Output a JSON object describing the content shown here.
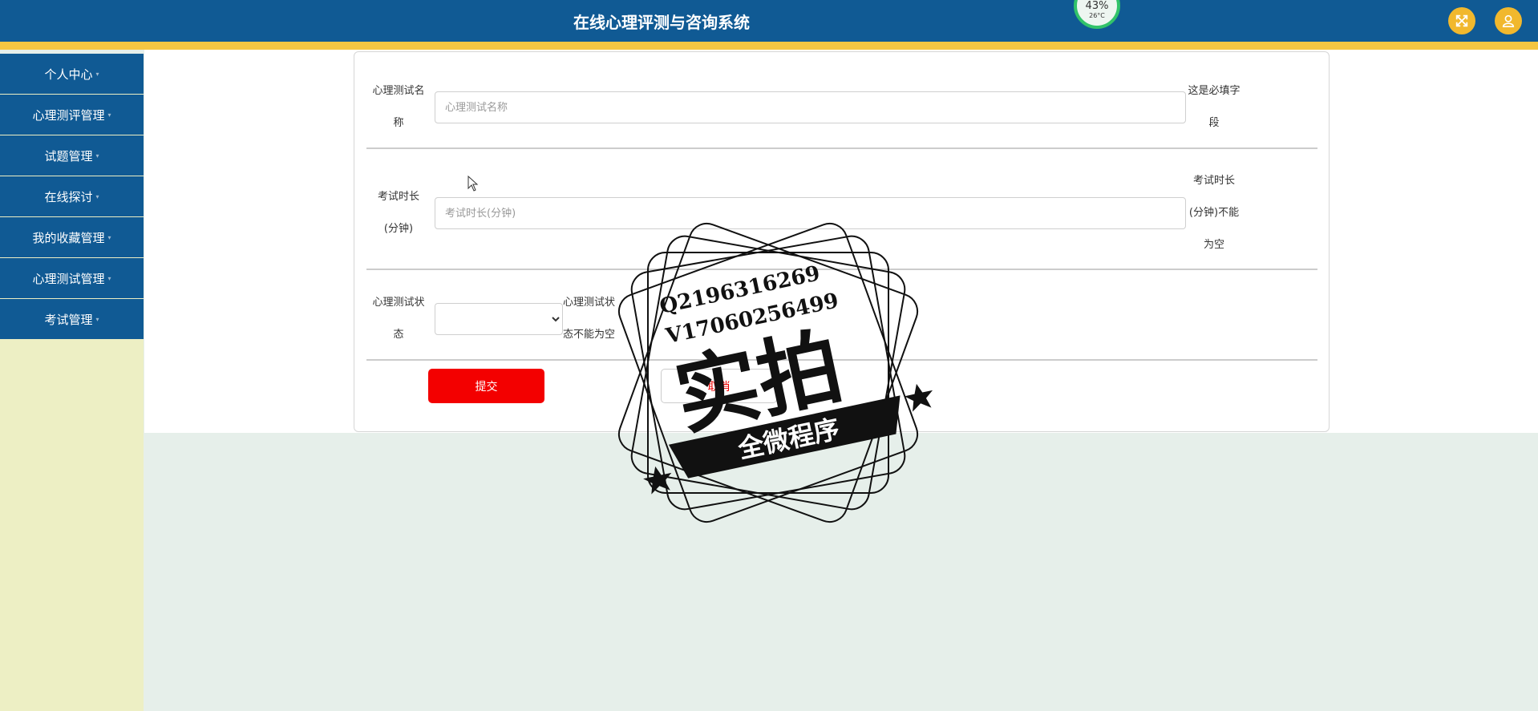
{
  "header": {
    "title": "在线心理评测与咨询系统",
    "status_widget": {
      "percent": "43%",
      "temperature": "26°C"
    },
    "accent_color": "#105a94",
    "stripe_color": "#f5c642"
  },
  "sidebar": {
    "items": [
      {
        "label": "个人中心"
      },
      {
        "label": "心理测评管理"
      },
      {
        "label": "试题管理"
      },
      {
        "label": "在线探讨"
      },
      {
        "label": "我的收藏管理"
      },
      {
        "label": "心理测试管理"
      },
      {
        "label": "考试管理"
      }
    ]
  },
  "form": {
    "name": {
      "label_line1": "心理测试名",
      "label_line2": "称",
      "placeholder": "心理测试名称",
      "hint_line1": "这是必填字",
      "hint_line2": "段"
    },
    "duration": {
      "label_line1": "考试时长",
      "label_line2": "(分钟)",
      "placeholder": "考试时长(分钟)",
      "hint_line1": "考试时长",
      "hint_line2": "(分钟)不能",
      "hint_line3": "为空"
    },
    "status": {
      "label_line1": "心理测试状",
      "label_line2": "态",
      "selected": "",
      "hint_line1": "心理测试状",
      "hint_line2": "态不能为空"
    },
    "submit_label": "提交",
    "cancel_label": "取消",
    "submit_color": "#f30000"
  },
  "watermark": {
    "line1": "Q2196316269",
    "line2": "V17060256499",
    "big_text": "实拍",
    "banner_text": "全微程序"
  }
}
